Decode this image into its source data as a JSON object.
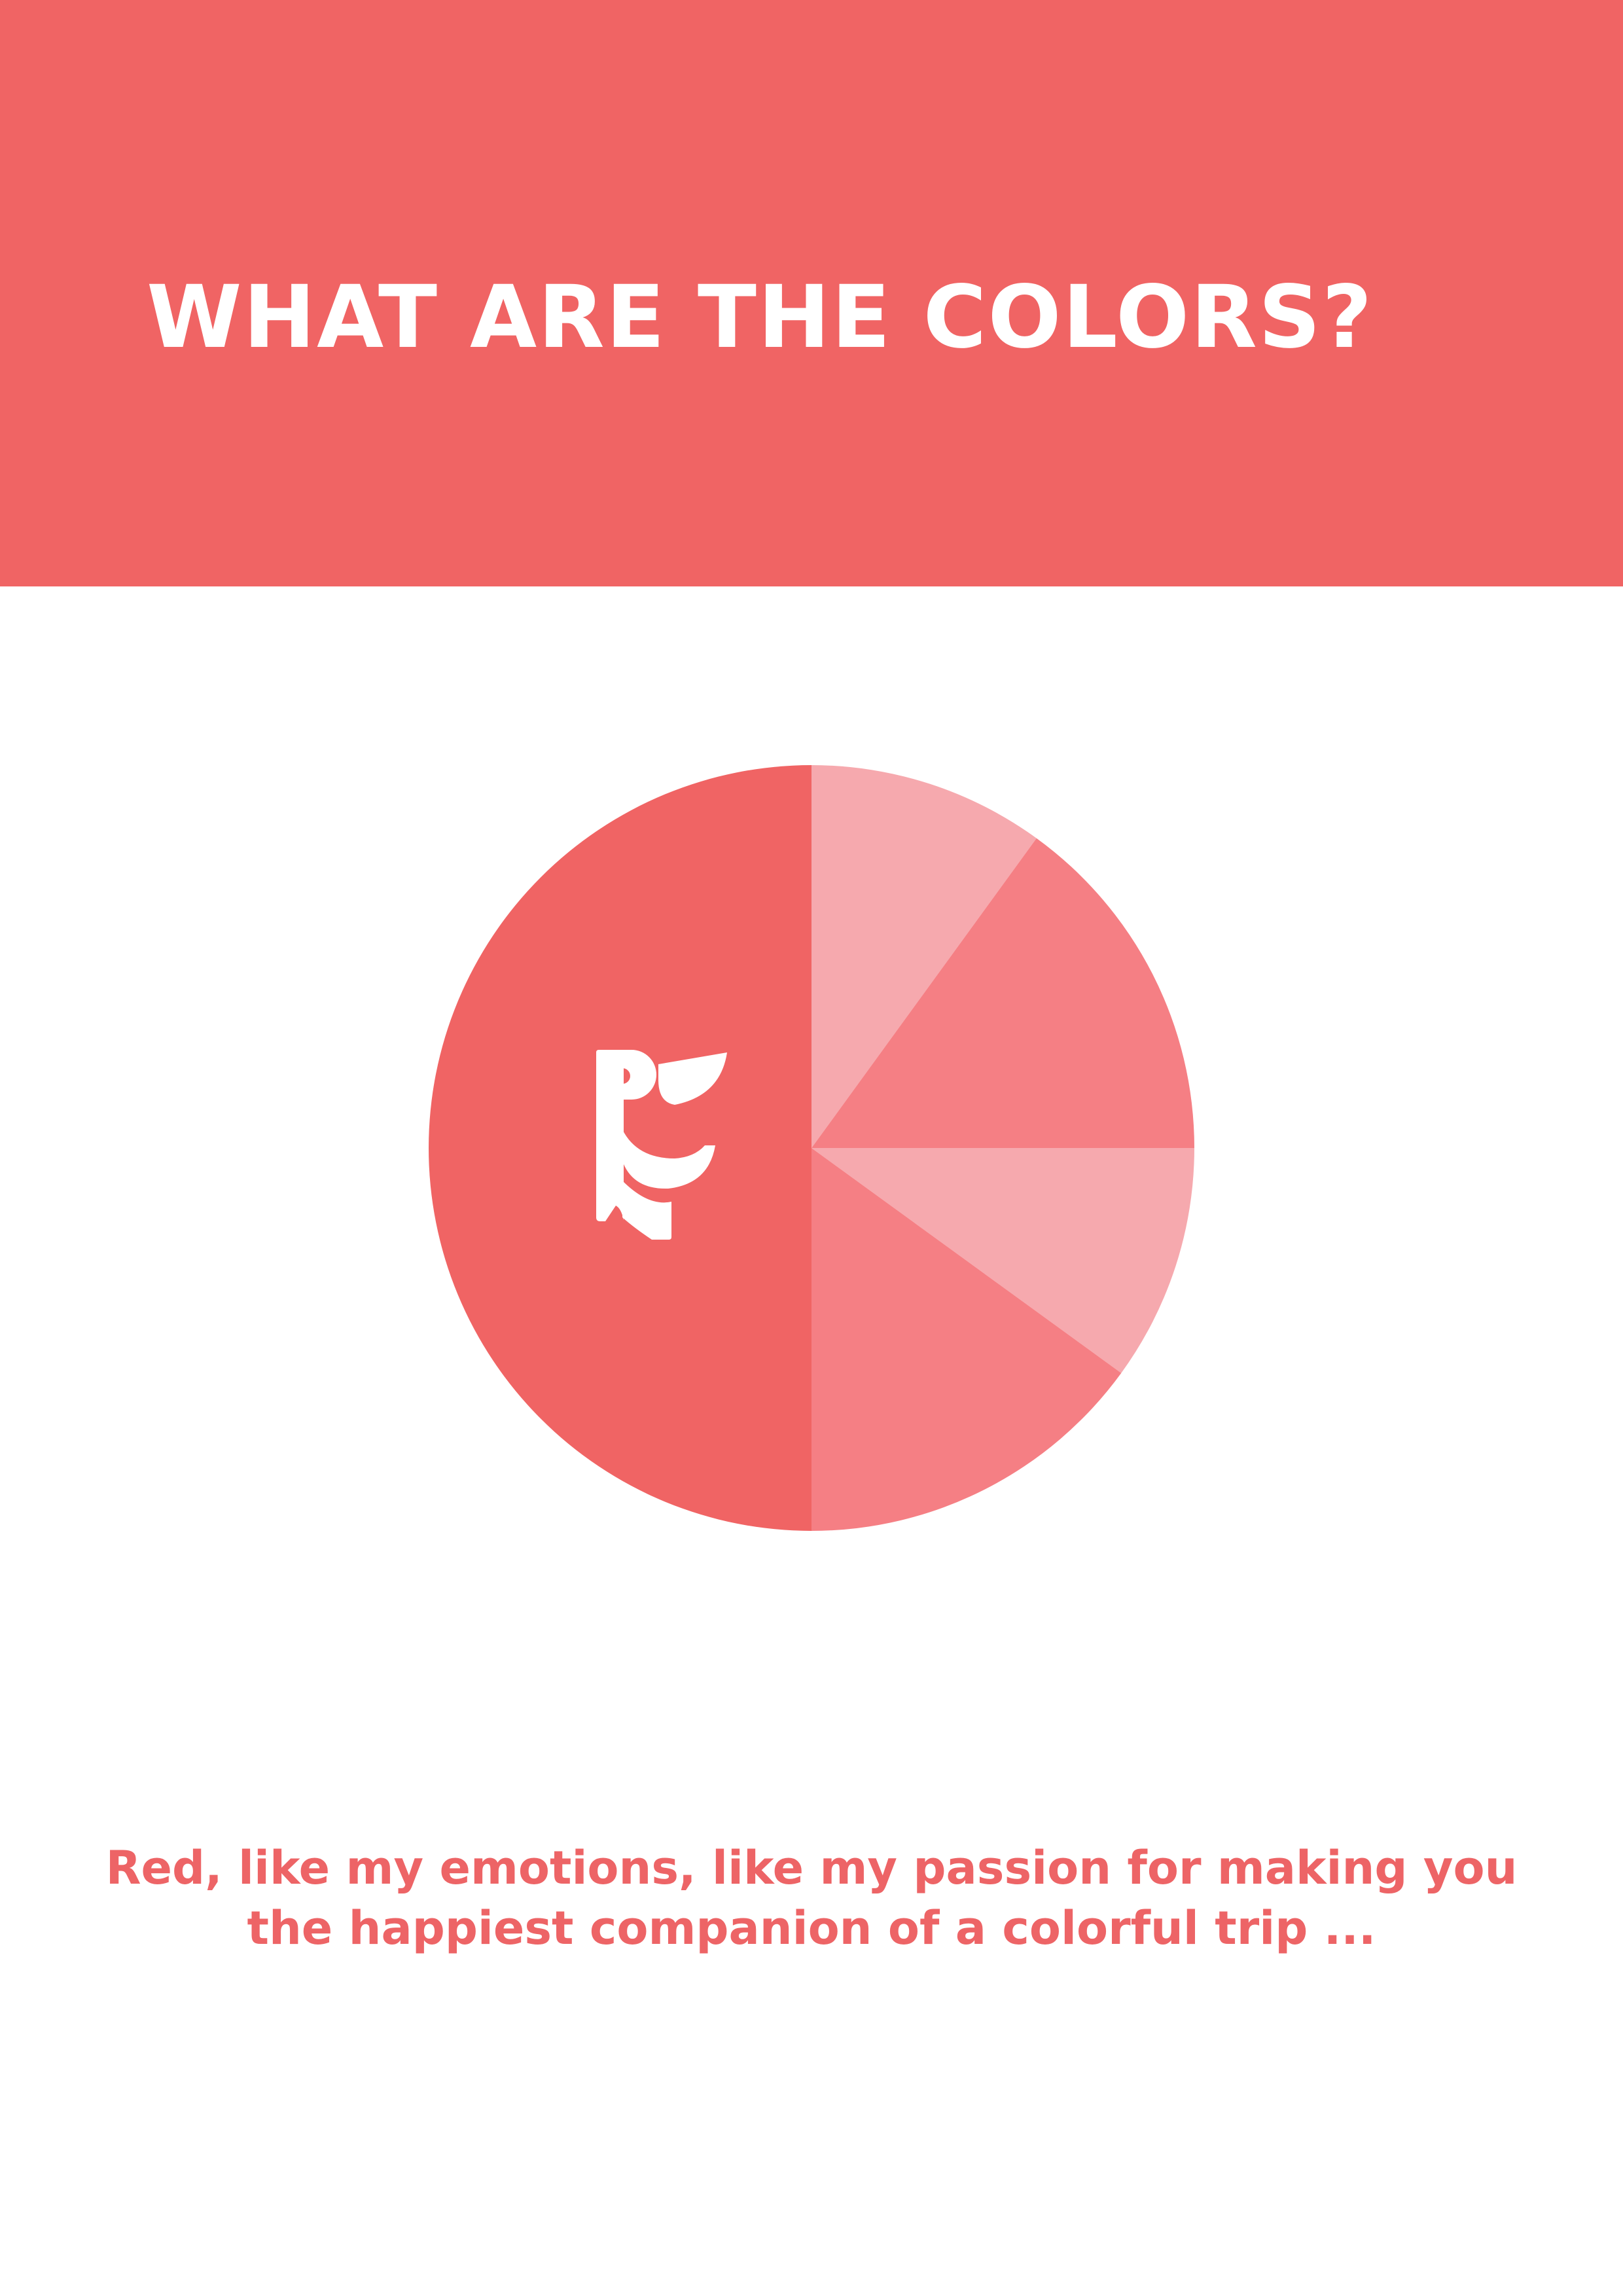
{
  "page": {
    "title": "WHAT ARE THE COLORS?",
    "caption_line1": "Red, like my emotions, like my passion for making you",
    "caption_line2": "the happiest companion of a colorful trip ..."
  },
  "logo": {
    "icon": "toucan-bird-logo",
    "color": "#ffffff"
  },
  "colors": {
    "header": "#f06464",
    "title_text": "#ffffff",
    "caption_text": "#ed6466"
  },
  "chart_data": {
    "type": "pie",
    "start": "top, clockwise",
    "values": [
      10,
      15,
      10,
      15,
      50
    ],
    "colors": [
      "#f6a9ae",
      "#f57f84",
      "#f6a9ae",
      "#f57f84",
      "#f06464"
    ],
    "title": "",
    "legend": "none"
  }
}
